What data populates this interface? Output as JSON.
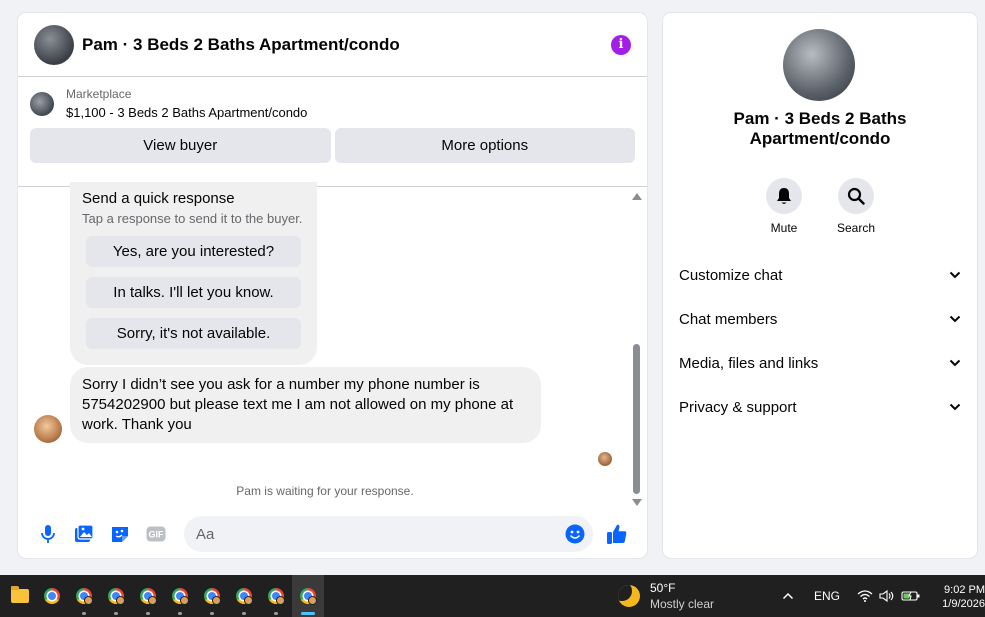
{
  "chat": {
    "title": "Pam · 3 Beds 2 Baths Apartment/condo",
    "info_icon": "i"
  },
  "marketplace": {
    "label": "Marketplace",
    "item": "$1,100 - 3 Beds 2 Baths Apartment/condo",
    "view_buyer": "View buyer",
    "more_options": "More options"
  },
  "quick_response": {
    "title": "Send a quick response",
    "subtitle": "Tap a response to send it to the buyer.",
    "options": [
      "Yes, are you interested?",
      "In talks. I'll let you know.",
      "Sorry, it's not available."
    ]
  },
  "message": {
    "text": "Sorry I didn’t see you ask for a number my phone number is 5754202900 but please text me I am not allowed on my phone at work. Thank you"
  },
  "waiting": "Pam is waiting for your response.",
  "composer": {
    "placeholder": "Aa",
    "icons": [
      "microphone-icon",
      "photo-icon",
      "sticker-icon",
      "gif-icon",
      "emoji-icon",
      "thumbs-up-icon"
    ],
    "gif_label": "GIF"
  },
  "info_panel": {
    "name": "Pam · 3 Beds 2 Baths Apartment/condo",
    "actions": {
      "mute": "Mute",
      "search": "Search"
    },
    "sections": [
      "Customize chat",
      "Chat members",
      "Media, files and links",
      "Privacy & support"
    ]
  },
  "taskbar": {
    "weather_temp": "50°F",
    "weather_cond": "Mostly clear",
    "language": "ENG",
    "time": "9:02 PM",
    "date": "1/9/2026"
  },
  "colors": {
    "accent": "#0866ff",
    "info": "#a21fe6",
    "bubble": "#f0f0f0",
    "button": "#e4e6eb"
  }
}
